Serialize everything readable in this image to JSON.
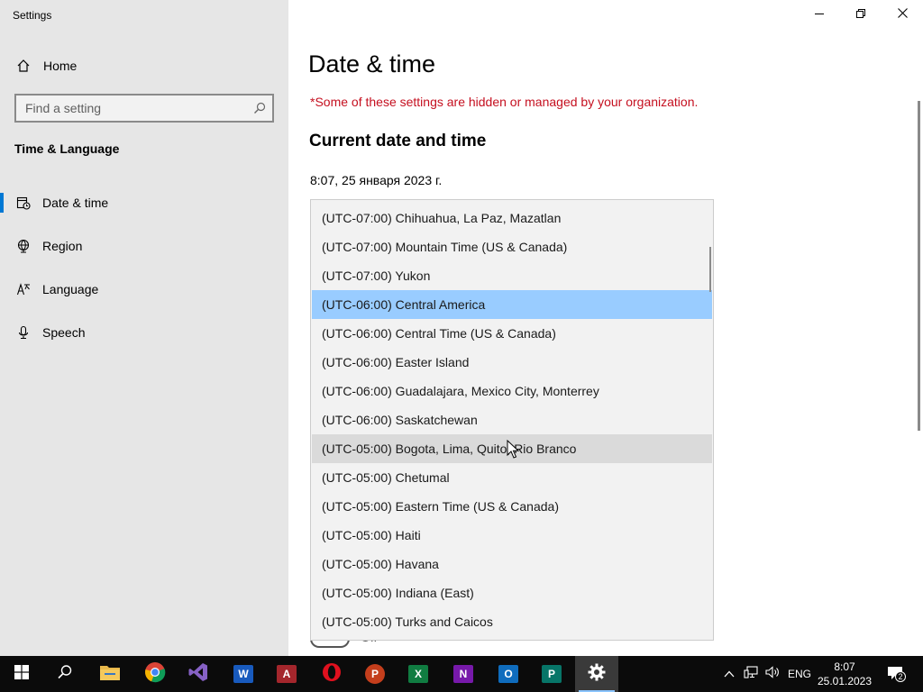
{
  "window": {
    "title": "Settings",
    "controls": {
      "minimize": "minimize-icon",
      "restore": "restore-icon",
      "close": "close-icon"
    }
  },
  "sidebar": {
    "home_label": "Home",
    "search_placeholder": "Find a setting",
    "section_title": "Time & Language",
    "items": [
      {
        "label": "Date & time",
        "icon": "clock-calendar-icon",
        "active": true
      },
      {
        "label": "Region",
        "icon": "globe-icon",
        "active": false
      },
      {
        "label": "Language",
        "icon": "language-icon",
        "active": false
      },
      {
        "label": "Speech",
        "icon": "microphone-icon",
        "active": false
      }
    ]
  },
  "main": {
    "title": "Date & time",
    "warning": "*Some of these settings are hidden or managed by your organization.",
    "section_title": "Current date and time",
    "current_datetime": "8:07, 25 января 2023 г.",
    "toggle_state": "Off"
  },
  "timezone_dropdown": {
    "items": [
      "(UTC-07:00) Chihuahua, La Paz, Mazatlan",
      "(UTC-07:00) Mountain Time (US & Canada)",
      "(UTC-07:00) Yukon",
      "(UTC-06:00) Central America",
      "(UTC-06:00) Central Time (US & Canada)",
      "(UTC-06:00) Easter Island",
      "(UTC-06:00) Guadalajara, Mexico City, Monterrey",
      "(UTC-06:00) Saskatchewan",
      "(UTC-05:00) Bogota, Lima, Quito, Rio Branco",
      "(UTC-05:00) Chetumal",
      "(UTC-05:00) Eastern Time (US & Canada)",
      "(UTC-05:00) Haiti",
      "(UTC-05:00) Havana",
      "(UTC-05:00) Indiana (East)",
      "(UTC-05:00) Turks and Caicos"
    ],
    "selected": "(UTC-06:00) Central America",
    "hovered": "(UTC-05:00) Bogota, Lima, Quito, Rio Branco"
  },
  "taskbar": {
    "apps": [
      {
        "name": "start",
        "icon": "windows-logo-icon"
      },
      {
        "name": "search",
        "icon": "search-icon"
      },
      {
        "name": "file-explorer",
        "icon": "folder-icon"
      },
      {
        "name": "chrome",
        "icon": "chrome-icon"
      },
      {
        "name": "visual-studio",
        "icon": "visual-studio-icon"
      },
      {
        "name": "word",
        "icon": "word-icon",
        "letter": "W"
      },
      {
        "name": "access",
        "icon": "access-icon",
        "letter": "A"
      },
      {
        "name": "opera",
        "icon": "opera-icon"
      },
      {
        "name": "powerpoint",
        "icon": "powerpoint-icon",
        "letter": "P"
      },
      {
        "name": "excel",
        "icon": "excel-icon",
        "letter": "X"
      },
      {
        "name": "onenote",
        "icon": "onenote-icon",
        "letter": "N"
      },
      {
        "name": "outlook",
        "icon": "outlook-icon",
        "letter": "O"
      },
      {
        "name": "publisher",
        "icon": "publisher-icon",
        "letter": "P"
      },
      {
        "name": "settings",
        "icon": "gear-icon",
        "active": true
      }
    ],
    "tray": {
      "language": "ENG",
      "time": "8:07",
      "date": "25.01.2023",
      "notification_count": "2"
    }
  },
  "colors": {
    "sidebar_bg": "#e6e6e6",
    "accent": "#0078d4",
    "warning": "#c50f1f",
    "selected_item": "#99ccff",
    "hover_item": "#dadada",
    "taskbar_bg": "#0b0b0b"
  }
}
